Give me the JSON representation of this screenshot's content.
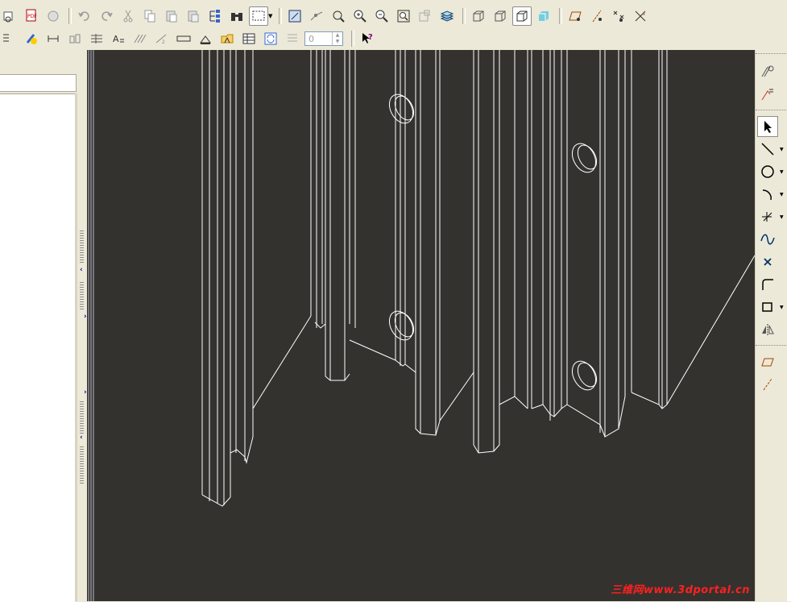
{
  "toolbar_top": {
    "icons": [
      "print-preview-icon",
      "pdf-icon",
      "print-icon",
      "undo-icon",
      "redo-icon",
      "cut-icon",
      "copy-icon",
      "paste-icon",
      "paste-special-icon",
      "tree-icon",
      "binoculars-icon",
      "select-rectangle-icon",
      "sketch-icon",
      "trim-icon",
      "pan-icon",
      "zoom-in-icon",
      "zoom-out-icon",
      "zoom-fit-icon",
      "view-palette-icon",
      "layers-icon",
      "front-view-icon",
      "back-view-icon",
      "iso-view-icon",
      "shaded-view-icon",
      "plane-icon",
      "axis-icon",
      "point-icon",
      "coord-icon"
    ]
  },
  "toolbar_bottom": {
    "icons": [
      "list-icon",
      "highlight-icon",
      "dimension-icon",
      "align-icon",
      "tolerance-icon",
      "text-icon",
      "hatch-icon",
      "scale-icon",
      "weld-icon",
      "datum-icon",
      "annotation-icon",
      "table-icon",
      "refresh-icon",
      "layer-list-icon"
    ],
    "spin_value": "0",
    "help_icon": "whats-this-icon"
  },
  "right_toolbar": {
    "icons": [
      "relations-icon",
      "equation-icon",
      "select-icon",
      "line-icon",
      "circle-icon",
      "arc-icon",
      "point-tool-icon",
      "spline-icon",
      "x-point-icon",
      "fillet-icon",
      "rectangle-icon",
      "mirror-icon",
      "plane-tool-icon",
      "centerline-icon"
    ]
  },
  "viewport": {
    "background": "#34322f",
    "watermark": "三维网www.3dportal.cn"
  }
}
